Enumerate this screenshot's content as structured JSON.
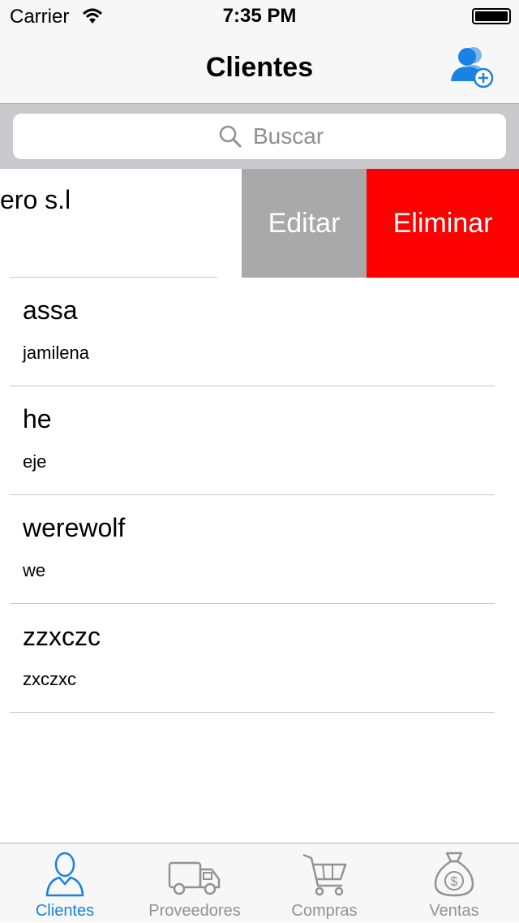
{
  "status_bar": {
    "carrier": "Carrier",
    "time": "7:35 PM"
  },
  "nav": {
    "title": "Clientes",
    "add_icon": "add-user-icon"
  },
  "search": {
    "placeholder": "Buscar",
    "value": ""
  },
  "swiped_row": {
    "name": "ero s.l",
    "actions": {
      "edit": "Editar",
      "delete": "Eliminar"
    },
    "colors": {
      "edit": "#a9a9a9",
      "delete": "#ff0000"
    }
  },
  "clients": [
    {
      "name": "assa",
      "city": "jamilena"
    },
    {
      "name": "he",
      "city": "eje"
    },
    {
      "name": "werewolf",
      "city": "we"
    },
    {
      "name": "zzxczc",
      "city": "zxczxc"
    }
  ],
  "tabs": [
    {
      "label": "Clientes",
      "icon": "person-icon",
      "active": true
    },
    {
      "label": "Proveedores",
      "icon": "truck-icon",
      "active": false
    },
    {
      "label": "Compras",
      "icon": "cart-icon",
      "active": false
    },
    {
      "label": "Ventas",
      "icon": "money-bag-icon",
      "active": false
    }
  ],
  "colors": {
    "accent": "#1a82e2",
    "inactive": "#929292"
  }
}
